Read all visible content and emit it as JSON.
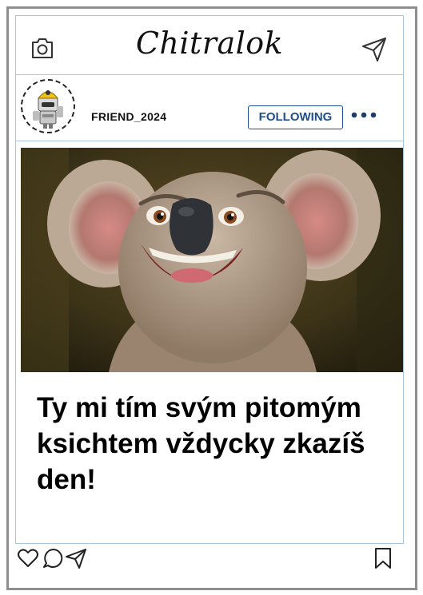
{
  "header": {
    "title": "Chitralok",
    "camera_icon": "camera-icon",
    "send_icon": "send-icon"
  },
  "post": {
    "username": "FRIEND_2024",
    "follow_label": "FOLLOWING",
    "more_icon": "more-dots-icon",
    "caption": "Ty mi tím svým pitomým ksichtem vždycky zkazíš den!"
  },
  "actions": {
    "like_icon": "heart-icon",
    "comment_icon": "comment-icon",
    "share_icon": "share-icon",
    "save_icon": "bookmark-icon"
  },
  "colors": {
    "frame": "#8f8f8f",
    "divider": "#a9c7dc",
    "follow_accent": "#1e4e8c"
  }
}
